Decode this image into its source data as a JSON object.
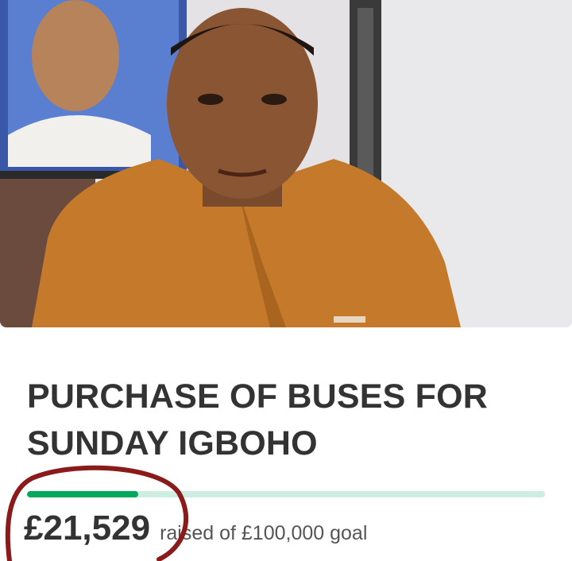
{
  "campaign": {
    "title": "PURCHASE OF BUSES FOR SUNDAY IGBOHO",
    "amount_raised": "£21,529",
    "goal_text": "raised of £100,000 goal",
    "progress_fraction": 0.215
  },
  "colors": {
    "progress_fill": "#02a95c",
    "progress_track": "#cdeee0",
    "annotation": "#8b1a1a",
    "shirt": "#c47a2a"
  }
}
